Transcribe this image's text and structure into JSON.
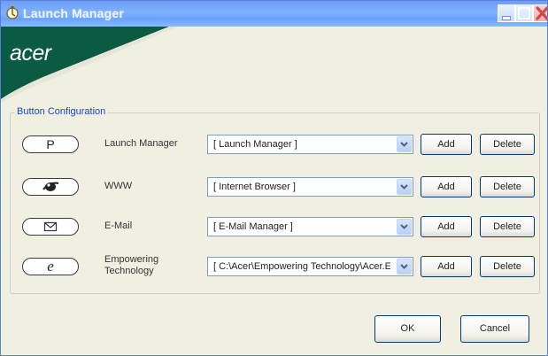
{
  "window": {
    "title": "Launch Manager",
    "brand_logo": "acer",
    "colors": {
      "titlebar": "#6aa3ff",
      "swoosh": "#0b5b44",
      "dialog_bg": "#f1efe2",
      "legend_text": "#1b44c8",
      "close_button": "#e85b5b"
    },
    "icons": {
      "app": "launch-manager-icon",
      "minimize": "minimize-icon",
      "maximize": "maximize-icon",
      "close": "close-icon"
    }
  },
  "config": {
    "group_title": "Button Configuration",
    "rows": [
      {
        "key_label": "P",
        "key_icon": "",
        "function_label": "Launch Manager",
        "assignment": "[ Launch Manager ]",
        "add_label": "Add",
        "delete_label": "Delete"
      },
      {
        "key_label": "",
        "key_icon": "internet-browser-icon",
        "function_label": "WWW",
        "assignment": "[ Internet Browser ]",
        "add_label": "Add",
        "delete_label": "Delete"
      },
      {
        "key_label": "✉",
        "key_icon": "envelope-icon",
        "function_label": "E-Mail",
        "assignment": "[ E-Mail Manager ]",
        "add_label": "Add",
        "delete_label": "Delete"
      },
      {
        "key_label": "e",
        "key_icon": "empowering-key-icon",
        "function_label_line1": "Empowering",
        "function_label_line2": "Technology",
        "assignment": "[ C:\\Acer\\Empowering Technology\\Acer.Er",
        "add_label": "Add",
        "delete_label": "Delete"
      }
    ]
  },
  "footer": {
    "ok_label": "OK",
    "cancel_label": "Cancel"
  }
}
